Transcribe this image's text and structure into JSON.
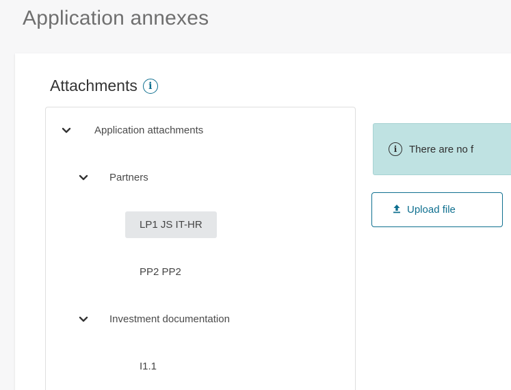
{
  "page": {
    "title": "Application annexes"
  },
  "attachments": {
    "title": "Attachments",
    "info_icon": "info-circle-icon"
  },
  "tree": {
    "root": {
      "label": "Application attachments",
      "expanded": true,
      "icon": "chevron-down-icon"
    },
    "partners": {
      "label": "Partners",
      "expanded": true,
      "icon": "chevron-down-icon",
      "items": [
        {
          "label": "LP1 JS IT-HR",
          "selected": true
        },
        {
          "label": "PP2 PP2",
          "selected": false
        }
      ]
    },
    "investment": {
      "label": "Investment documentation",
      "expanded": true,
      "icon": "chevron-down-icon",
      "items": [
        {
          "label": "I1.1",
          "selected": false
        }
      ]
    }
  },
  "alert": {
    "text": "There are no f",
    "icon": "info-circle-icon"
  },
  "upload": {
    "label": "Upload file",
    "icon": "upload-icon"
  },
  "colors": {
    "accent": "#0e6f8f",
    "alert_bg": "#bfe2e2",
    "selected_bg": "#e4e6e8",
    "title_text": "#6f6f6f"
  }
}
